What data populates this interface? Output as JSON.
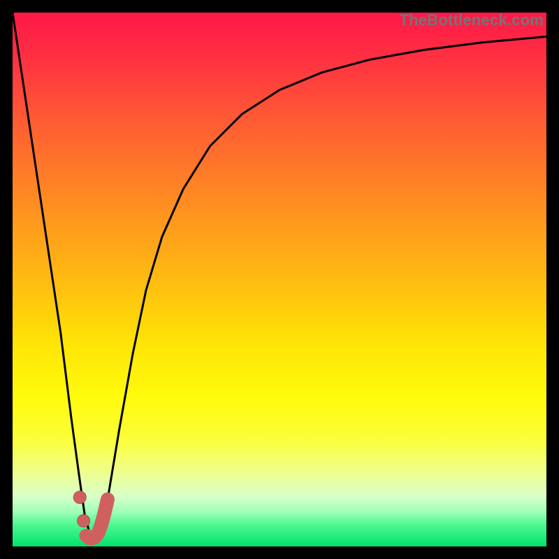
{
  "watermark": "TheBottleneck.com",
  "chart_data": {
    "type": "line",
    "title": "",
    "xlabel": "",
    "ylabel": "",
    "xlim": [
      0,
      100
    ],
    "ylim": [
      0,
      100
    ],
    "background_gradient": {
      "stops": [
        {
          "offset": 0.0,
          "color": "#ff1748"
        },
        {
          "offset": 0.08,
          "color": "#ff2f42"
        },
        {
          "offset": 0.2,
          "color": "#ff5a34"
        },
        {
          "offset": 0.35,
          "color": "#ff8b22"
        },
        {
          "offset": 0.5,
          "color": "#ffbb11"
        },
        {
          "offset": 0.62,
          "color": "#ffe407"
        },
        {
          "offset": 0.72,
          "color": "#fffb0c"
        },
        {
          "offset": 0.8,
          "color": "#fbff3a"
        },
        {
          "offset": 0.86,
          "color": "#efff8c"
        },
        {
          "offset": 0.905,
          "color": "#d9ffc8"
        },
        {
          "offset": 0.935,
          "color": "#9fffb8"
        },
        {
          "offset": 0.96,
          "color": "#4cf88f"
        },
        {
          "offset": 1.0,
          "color": "#00e36b"
        }
      ]
    },
    "series": [
      {
        "name": "bottleneck-curve",
        "color": "#000000",
        "x": [
          0,
          3,
          6,
          9,
          11,
          12.5,
          13.5,
          14.6,
          15.5,
          16.5,
          18,
          20,
          22.5,
          25,
          28,
          32,
          37,
          43,
          50,
          58,
          67,
          77,
          88,
          100
        ],
        "y": [
          100,
          80,
          60,
          40,
          24,
          13,
          6,
          1.8,
          1.5,
          3.2,
          10,
          22,
          36,
          48,
          58,
          67,
          75,
          81,
          85.5,
          88.8,
          91.2,
          93.0,
          94.4,
          95.5
        ]
      }
    ],
    "markers": {
      "color": "#d06060",
      "stroke": "#b24a4a",
      "points": [
        {
          "x": 12.6,
          "y": 9.2
        },
        {
          "x": 13.3,
          "y": 4.8
        }
      ],
      "thick_segment": {
        "x": [
          13.8,
          14.3,
          14.8,
          15.4,
          16.0,
          16.6,
          17.2,
          17.8
        ],
        "y": [
          2.0,
          1.6,
          1.5,
          1.7,
          2.4,
          4.0,
          6.2,
          8.8
        ]
      }
    }
  }
}
